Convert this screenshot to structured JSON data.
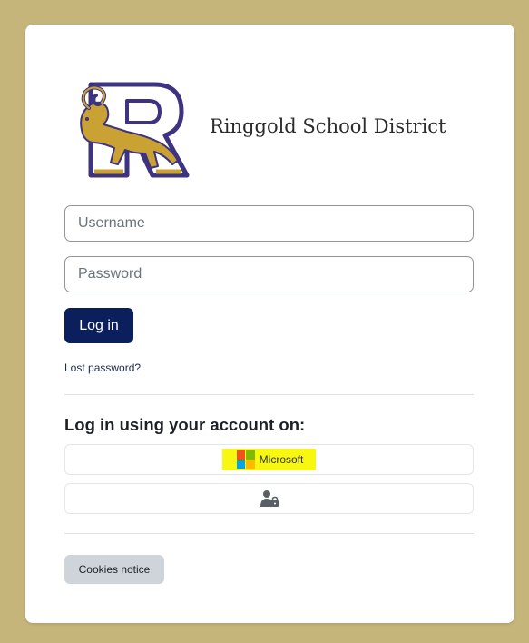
{
  "site": {
    "name": "Ringgold School District",
    "logo": "ringgold-ram-r-logo"
  },
  "login": {
    "username_placeholder": "Username",
    "password_placeholder": "Password",
    "username_value": "",
    "password_value": "",
    "submit_label": "Log in",
    "lost_password_label": "Lost password?"
  },
  "identity_providers": {
    "heading": "Log in using your account on:",
    "items": [
      {
        "label": "Microsoft",
        "icon": "microsoft-logo-icon",
        "highlighted": true
      },
      {
        "label": "",
        "icon": "user-lock-icon",
        "highlighted": false
      }
    ]
  },
  "footer": {
    "cookies_label": "Cookies notice"
  },
  "colors": {
    "background": "#c6b57b",
    "primary_button": "#0a1f5c",
    "logo_gold": "#c9a233",
    "logo_purple": "#3d3380",
    "highlight": "#f7f711"
  }
}
